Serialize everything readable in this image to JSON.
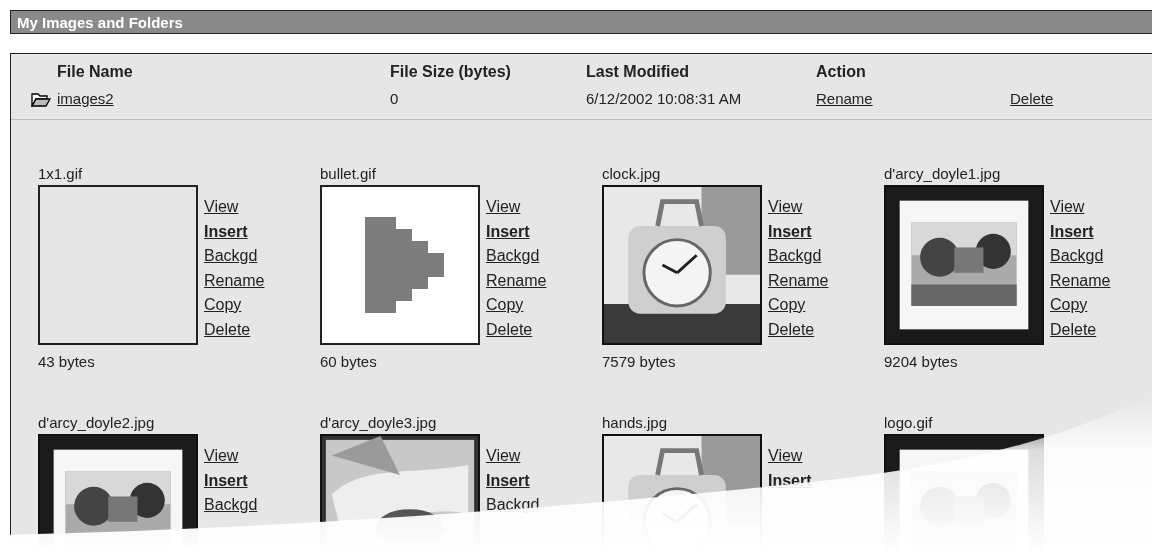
{
  "title": "My Images and Folders",
  "folders": {
    "columns": [
      "File Name",
      "File Size (bytes)",
      "Last Modified",
      "Action"
    ],
    "rows": [
      {
        "name": "images2",
        "size": "0",
        "modified": "6/12/2002 10:08:31 AM",
        "actions": [
          "Rename",
          "Delete"
        ]
      }
    ]
  },
  "images": [
    {
      "name": "1x1.gif",
      "kind": "blank",
      "size": "43 bytes",
      "links": [
        {
          "label": "View",
          "bold": false
        },
        {
          "label": "Insert",
          "bold": true
        },
        {
          "label": "Backgd",
          "bold": false
        },
        {
          "label": "Rename",
          "bold": false
        },
        {
          "label": "Copy",
          "bold": false
        },
        {
          "label": "Delete",
          "bold": false
        }
      ]
    },
    {
      "name": "bullet.gif",
      "kind": "bullet",
      "size": "60 bytes",
      "links": [
        {
          "label": "View",
          "bold": false
        },
        {
          "label": "Insert",
          "bold": true
        },
        {
          "label": "Backgd",
          "bold": false
        },
        {
          "label": "Rename",
          "bold": false
        },
        {
          "label": "Copy",
          "bold": false
        },
        {
          "label": "Delete",
          "bold": false
        }
      ]
    },
    {
      "name": "clock.jpg",
      "kind": "picture",
      "size": "7579 bytes",
      "links": [
        {
          "label": "View",
          "bold": false
        },
        {
          "label": "Insert",
          "bold": true
        },
        {
          "label": "Backgd",
          "bold": false
        },
        {
          "label": "Rename",
          "bold": false
        },
        {
          "label": "Copy",
          "bold": false
        },
        {
          "label": "Delete",
          "bold": false
        }
      ]
    },
    {
      "name": "d'arcy_doyle1.jpg",
      "kind": "picture",
      "size": "9204 bytes",
      "links": [
        {
          "label": "View",
          "bold": false
        },
        {
          "label": "Insert",
          "bold": true
        },
        {
          "label": "Backgd",
          "bold": false
        },
        {
          "label": "Rename",
          "bold": false
        },
        {
          "label": "Copy",
          "bold": false
        },
        {
          "label": "Delete",
          "bold": false
        }
      ]
    },
    {
      "name": "d'arcy_doyle2.jpg",
      "kind": "picture",
      "links": [
        {
          "label": "View",
          "bold": false
        },
        {
          "label": "Insert",
          "bold": true
        },
        {
          "label": "Backgd",
          "bold": false
        }
      ]
    },
    {
      "name": "d'arcy_doyle3.jpg",
      "kind": "picture",
      "links": [
        {
          "label": "View",
          "bold": false
        },
        {
          "label": "Insert",
          "bold": true
        },
        {
          "label": "Backgd",
          "bold": false
        }
      ]
    },
    {
      "name": "hands.jpg",
      "kind": "picture",
      "links": [
        {
          "label": "View",
          "bold": false
        },
        {
          "label": "Insert",
          "bold": true
        }
      ]
    },
    {
      "name": "logo.gif",
      "kind": "picture"
    }
  ]
}
